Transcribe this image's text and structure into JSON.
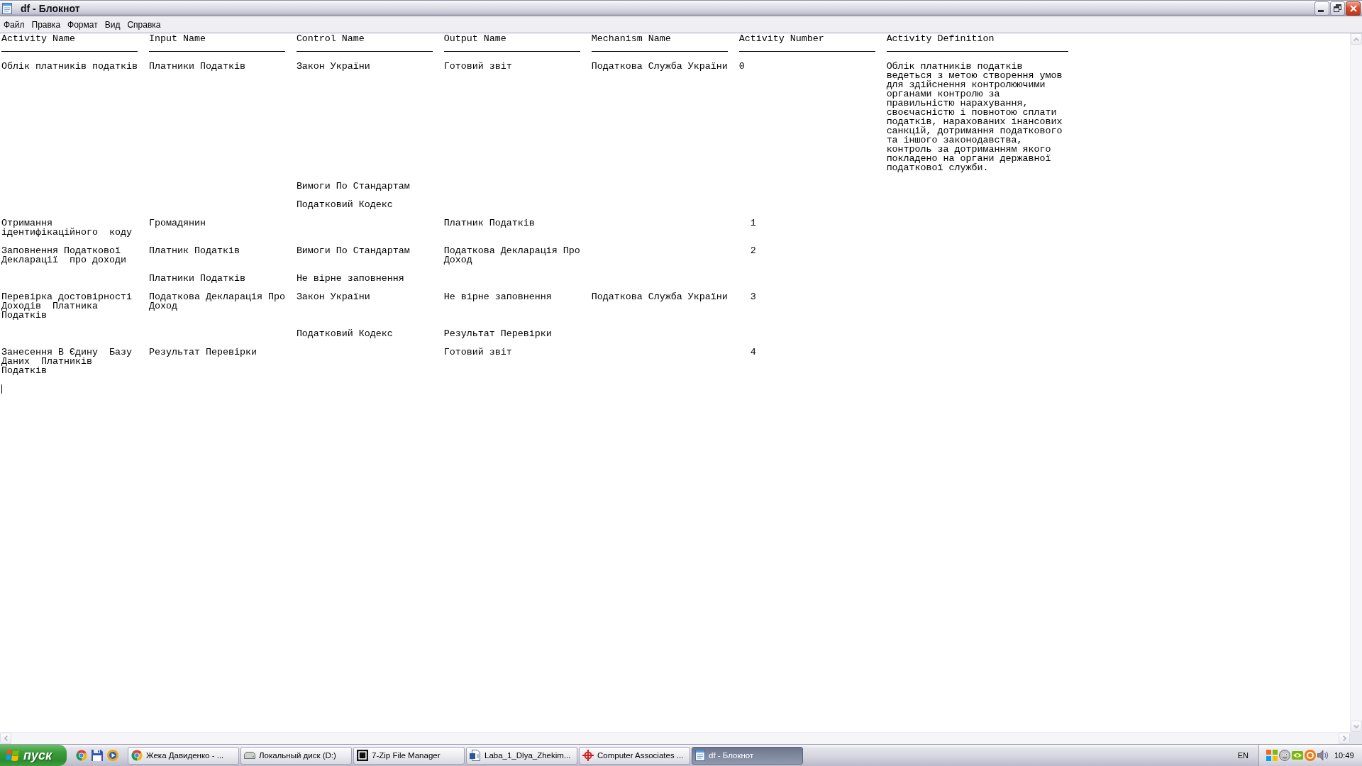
{
  "window": {
    "title": "df - Блокнот"
  },
  "menu": [
    "Файл",
    "Правка",
    "Формат",
    "Вид",
    "Справка"
  ],
  "document": {
    "columns": [
      "Activity Name",
      "Input Name",
      "Control Name",
      "Output Name",
      "Mechanism Name",
      "Activity Number",
      "Activity Definition"
    ],
    "rows": [
      {
        "activity_name": "Облік платників податків",
        "input_name": "Платники Податків",
        "control_name": "Закон України",
        "output_name": "Готовий звіт",
        "mechanism_name": "Податкова Служба України",
        "activity_number": "0",
        "activity_definition": "Облік платників податків ведеться з метою створення умов для здійснення контролюючими органами контролю за правильністю нарахування, своєчасністю і повнотою сплати податків, нарахованих інансових санкцій, дотримання податкового та іншого законодавства, контроль за дотриманням якого покладено на органи державної податкової служби."
      },
      {
        "control_name": "Вимоги По Стандартам"
      },
      {
        "control_name": "Податковий Кодекс"
      },
      {
        "activity_name": "Отримання ідентифікаційного  коду",
        "input_name": "Громадянин",
        "output_name": "Платник Податків",
        "activity_number": "  1"
      },
      {
        "activity_name": "Заповнення Податкової Декларації  про доходи",
        "input_name": "Платник Податків",
        "control_name": "Вимоги По Стандартам",
        "output_name": "Податкова Декларація Про Доход",
        "activity_number": "  2"
      },
      {
        "input_name": "Платники Податків",
        "control_name": "Не вірне заповнення"
      },
      {
        "activity_name": "Перевірка достовірності Доходів  Платника Податків",
        "input_name": "Податкова Декларація Про Доход",
        "control_name": "Закон України",
        "output_name": "Не вірне заповнення",
        "mechanism_name": "Податкова Служба України",
        "activity_number": "  3"
      },
      {
        "control_name": "Податковий Кодекс",
        "output_name": "Результат Перевірки"
      },
      {
        "activity_name": "Занесення В Єдину  Базу Даних  Платників Податків",
        "input_name": "Результат Перевірки",
        "output_name": "Готовий звіт",
        "activity_number": "  4"
      }
    ]
  },
  "taskbar": {
    "start_button": "пуск",
    "tasks": [
      {
        "label": "Жека Давиденко - ...",
        "selected": false
      },
      {
        "label": "Локальный диск (D:)",
        "selected": false
      },
      {
        "label": "7-Zip File Manager",
        "selected": false
      },
      {
        "label": "Laba_1_Dlya_Zhekim...",
        "selected": false
      },
      {
        "label": "Computer Associates ...",
        "selected": false
      },
      {
        "label": "df - Блокнот",
        "selected": true
      }
    ],
    "language": "EN",
    "clock": "10:49"
  }
}
